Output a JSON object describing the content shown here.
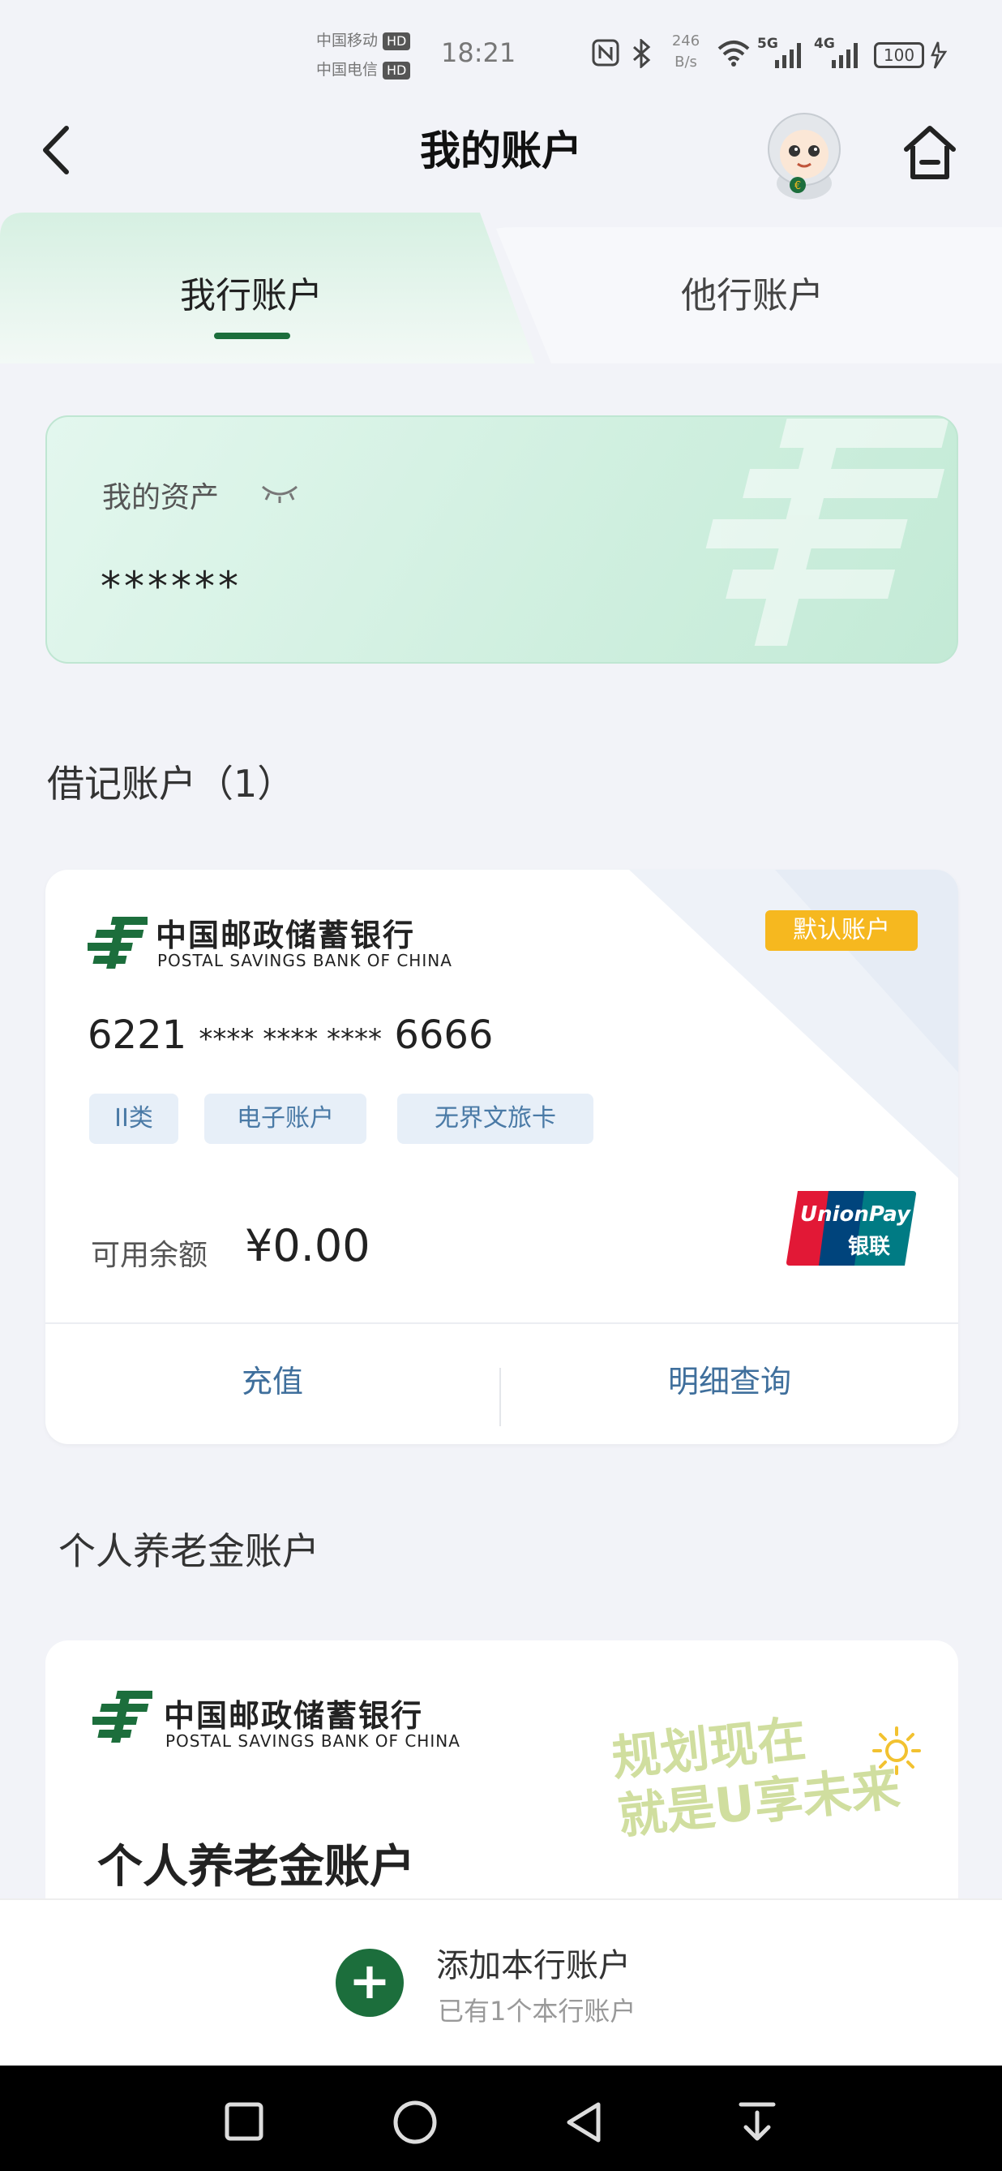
{
  "status_bar": {
    "carrier_1": "中国移动",
    "carrier_2": "中国电信",
    "hd": "HD",
    "time": "18:21",
    "net_speed_value": "246",
    "net_speed_unit": "B/s",
    "signal_1": "5G",
    "signal_2": "4G",
    "battery": "100"
  },
  "header": {
    "title": "我的账户",
    "back_icon": "chevron-left-icon",
    "mascot_icon": "robot-mascot-icon",
    "home_icon": "home-icon"
  },
  "tabs": [
    {
      "label": "我行账户",
      "active": true
    },
    {
      "label": "他行账户",
      "active": false
    }
  ],
  "assets": {
    "label": "我的资产",
    "value": "******",
    "eye_icon": "eye-closed-icon"
  },
  "debit_section": {
    "title": "借记账户（1）"
  },
  "debit_card": {
    "bank_name_cn": "中国邮政储蓄银行",
    "bank_name_en": "POSTAL SAVINGS BANK OF CHINA",
    "default_badge": "默认账户",
    "number_start": "6221",
    "number_mask": "**** **** ****",
    "number_end": "6666",
    "tags": [
      "II类",
      "电子账户",
      "无界文旅卡"
    ],
    "balance_label": "可用余额",
    "balance_value": "¥0.00",
    "unionpay_en": "UnionPay",
    "unionpay_cn": "银联",
    "actions": [
      "充值",
      "明细查询"
    ]
  },
  "pension_section": {
    "title": "个人养老金账户"
  },
  "pension_card": {
    "bank_name_cn": "中国邮政储蓄银行",
    "bank_name_en": "POSTAL SAVINGS BANK OF CHINA",
    "slogan_line1": "规划现在",
    "slogan_line2": "就是U享未来",
    "title": "个人养老金账户"
  },
  "add_bar": {
    "label": "添加本行账户",
    "sub": "已有1个本行账户"
  },
  "colors": {
    "brand_green": "#1c6e3c",
    "badge_yellow": "#f6b81f",
    "action_blue": "#3f6f9c",
    "tag_bg": "#e7eff8"
  }
}
